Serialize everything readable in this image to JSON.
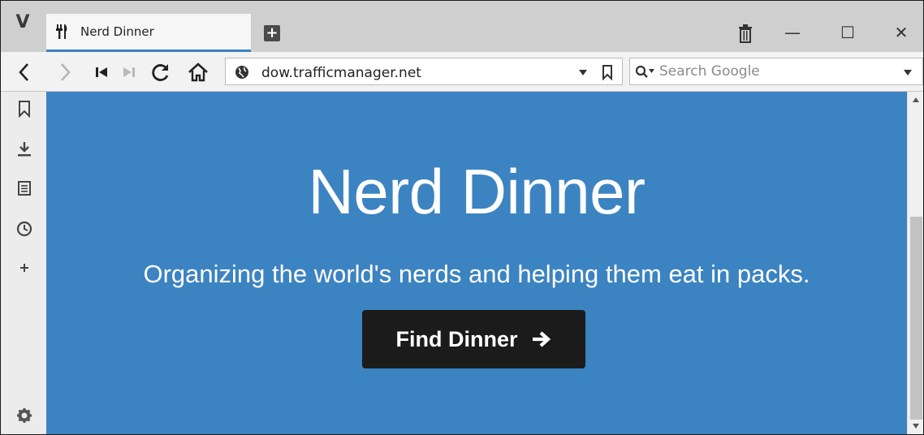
{
  "browser": {
    "logo": "V",
    "tab": {
      "title": "Nerd Dinner",
      "favicon": "fork-knife-icon"
    },
    "new_tab_label": "+",
    "window_controls": {
      "trash": "trash-icon",
      "minimize": "—",
      "maximize": "☐",
      "close": "✕"
    }
  },
  "navbar": {
    "url": "dow.trafficmanager.net",
    "search_placeholder": "Search Google",
    "icons": [
      "back-icon",
      "forward-icon",
      "rewind-icon",
      "fast-forward-icon",
      "reload-icon",
      "home-icon",
      "globe-icon",
      "dropdown-icon",
      "bookmark-icon",
      "search-engine-icon"
    ]
  },
  "sidepanel": {
    "icons": [
      "bookmark-icon",
      "download-icon",
      "notes-icon",
      "history-icon",
      "add-panel-icon",
      "settings-icon"
    ]
  },
  "page": {
    "title": "Nerd Dinner",
    "subtitle": "Organizing the world's nerds and helping them eat in packs.",
    "cta_label": "Find Dinner",
    "colors": {
      "hero_bg": "#3c83c1",
      "button_bg": "#1b1b1b",
      "text": "#ffffff"
    }
  }
}
